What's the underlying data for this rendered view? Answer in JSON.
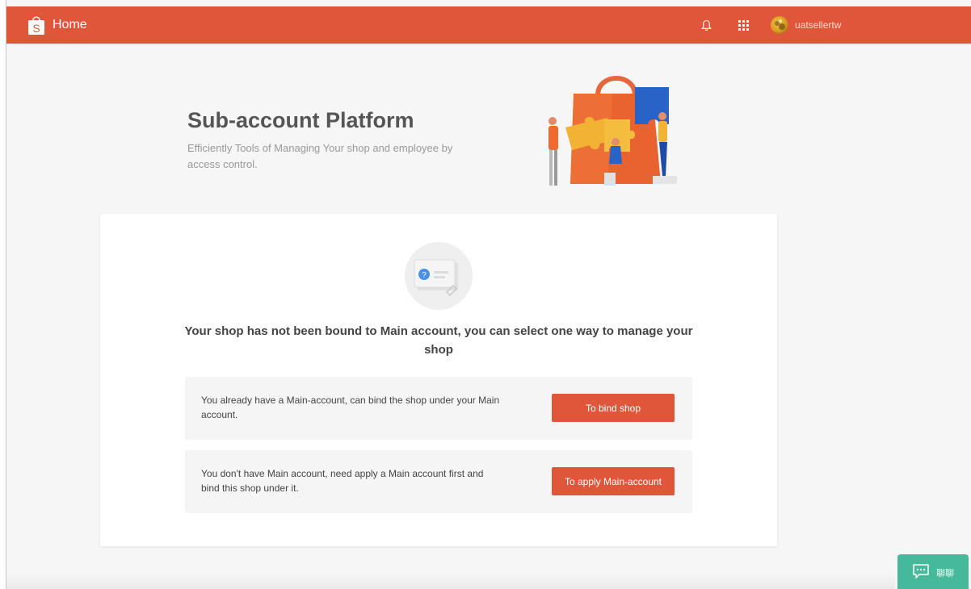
{
  "header": {
    "home_label": "Home",
    "username": "uatsellertw"
  },
  "hero": {
    "title": "Sub-account Platform",
    "subtitle": "Efficiently Tools of Managing Your shop and employee by access control."
  },
  "card": {
    "heading": "Your shop has not been bound to Main account, you can select one way to manage your shop",
    "options": [
      {
        "text": "You already have a Main-account, can bind the shop under your Main account.",
        "button_label": "To bind shop"
      },
      {
        "text": "You don't have Main account, need apply a Main account first and bind this shop under it.",
        "button_label": "To apply Main-account"
      }
    ]
  },
  "chat": {
    "label": "聊聊"
  },
  "colors": {
    "brand": "#e0563a",
    "chat": "#45b99a"
  },
  "icons": [
    "shopee-logo-icon",
    "bell-icon",
    "apps-grid-icon",
    "avatar",
    "empty-state-icon",
    "chat-icon"
  ]
}
